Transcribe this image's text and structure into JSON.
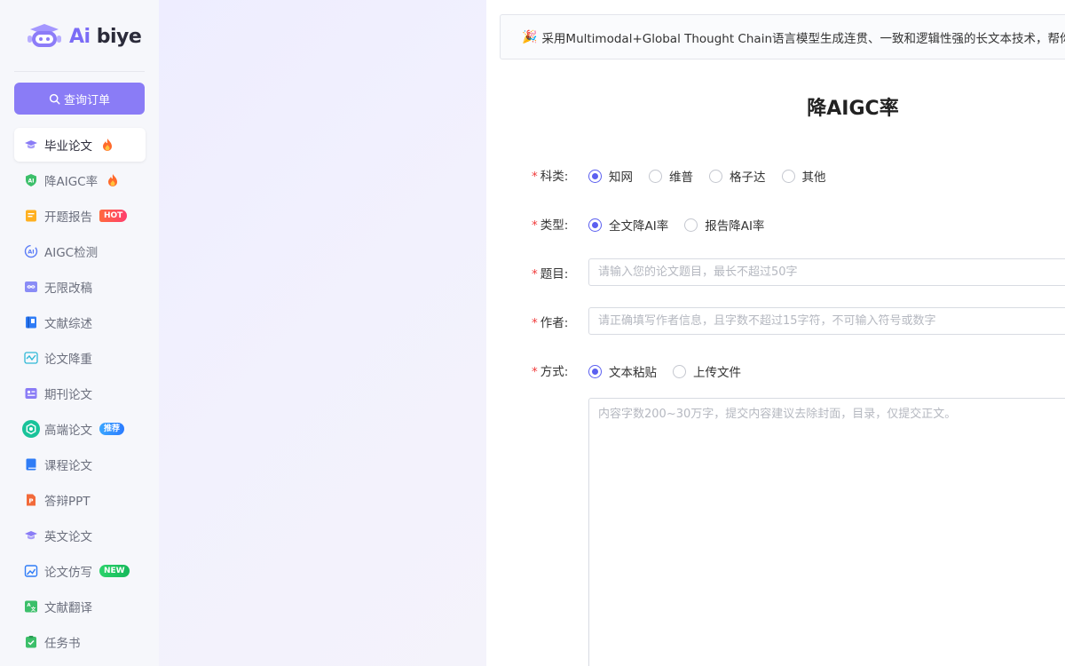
{
  "brand": {
    "ai": "Ai",
    "biye": " biye",
    "accent": "#7b6cf6"
  },
  "sidebar": {
    "query_label": "查询订单",
    "items": [
      {
        "label": "毕业论文",
        "icon": "graduation-cap-icon",
        "active": true,
        "badge": "fire"
      },
      {
        "label": "降AIGC率",
        "icon": "ai-shield-icon",
        "badge": "fire"
      },
      {
        "label": "开题报告",
        "icon": "document-icon",
        "badge": "HOT"
      },
      {
        "label": "AIGC检测",
        "icon": "ai-detect-icon"
      },
      {
        "label": "无限改稿",
        "icon": "infinity-icon"
      },
      {
        "label": "文献综述",
        "icon": "book-icon"
      },
      {
        "label": "论文降重",
        "icon": "wave-chart-icon"
      },
      {
        "label": "期刊论文",
        "icon": "journal-icon"
      },
      {
        "label": "高端论文",
        "icon": "openai-icon",
        "badge": "推荐"
      },
      {
        "label": "课程论文",
        "icon": "notebook-icon"
      },
      {
        "label": "答辩PPT",
        "icon": "ppt-icon"
      },
      {
        "label": "英文论文",
        "icon": "graduation-cap-icon"
      },
      {
        "label": "论文仿写",
        "icon": "image-edit-icon",
        "badge": "NEW"
      },
      {
        "label": "文献翻译",
        "icon": "translate-icon"
      },
      {
        "label": "任务书",
        "icon": "task-icon"
      }
    ]
  },
  "main": {
    "notice": "采用Multimodal+Global Thought Chain语言模型生成连贯、一致和逻辑性强的长文本技术，帮你",
    "title": "降AIGC率",
    "fields": {
      "category": {
        "label": "科类:",
        "options": [
          "知网",
          "维普",
          "格子达",
          "其他"
        ],
        "selected": "知网"
      },
      "type": {
        "label": "类型:",
        "options": [
          "全文降AI率",
          "报告降AI率"
        ],
        "selected": "全文降AI率"
      },
      "topic": {
        "label": "题目:",
        "placeholder": "请输入您的论文题目，最长不超过50字"
      },
      "author": {
        "label": "作者:",
        "placeholder": "请正确填写作者信息，且字数不超过15字符，不可输入符号或数字"
      },
      "method": {
        "label": "方式:",
        "options": [
          "文本粘贴",
          "上传文件"
        ],
        "selected": "文本粘贴"
      },
      "content": {
        "placeholder": "内容字数200~30万字，提交内容建议去除封面，目录，仅提交正文。"
      }
    }
  }
}
